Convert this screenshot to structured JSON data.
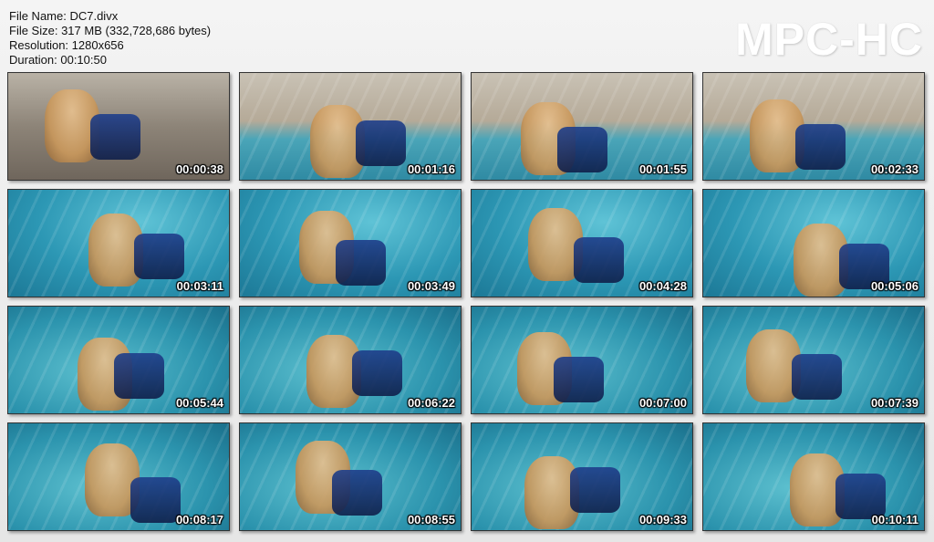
{
  "file_info": {
    "name_line": "File Name: DC7.divx",
    "size_line": "File Size: 317 MB (332,728,686 bytes)",
    "resolution_line": "Resolution: 1280x656",
    "duration_line": "Duration: 00:10:50"
  },
  "logo": "MPC-HC",
  "thumbnails": [
    {
      "time": "00:00:38",
      "scene": "patio"
    },
    {
      "time": "00:01:16",
      "scene": "pool-top"
    },
    {
      "time": "00:01:55",
      "scene": "pool-top"
    },
    {
      "time": "00:02:33",
      "scene": "pool-top"
    },
    {
      "time": "00:03:11",
      "scene": "under"
    },
    {
      "time": "00:03:49",
      "scene": "under"
    },
    {
      "time": "00:04:28",
      "scene": "under"
    },
    {
      "time": "00:05:06",
      "scene": "under"
    },
    {
      "time": "00:05:44",
      "scene": "under2"
    },
    {
      "time": "00:06:22",
      "scene": "under2"
    },
    {
      "time": "00:07:00",
      "scene": "under2"
    },
    {
      "time": "00:07:39",
      "scene": "under2"
    },
    {
      "time": "00:08:17",
      "scene": "under2"
    },
    {
      "time": "00:08:55",
      "scene": "under2"
    },
    {
      "time": "00:09:33",
      "scene": "under2"
    },
    {
      "time": "00:10:11",
      "scene": "under2"
    }
  ]
}
